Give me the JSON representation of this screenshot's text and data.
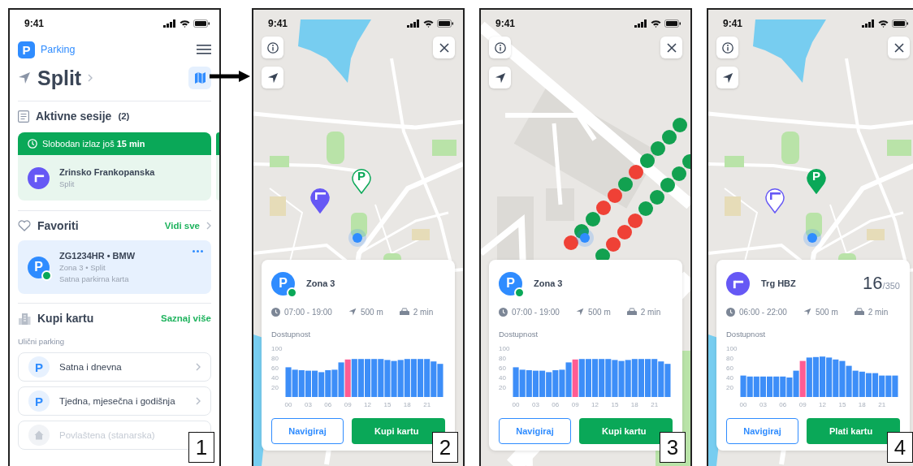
{
  "screens": [
    {
      "kind": "home",
      "label": "1",
      "status_bar": {
        "time": "9:41"
      },
      "header": {
        "logo": "P",
        "app_name": "Parking"
      },
      "city": {
        "name": "Split"
      },
      "active_sessions": {
        "title": "Aktivne sesije",
        "count": "(2)",
        "sessions": [
          {
            "banner": "Slobodan izlaz još **15 min**",
            "name": "Zrinsko Frankopanska",
            "city": "Split"
          }
        ]
      },
      "favorites": {
        "title": "Favoriti",
        "link": "Vidi sve",
        "items": [
          {
            "glyph": "P",
            "title": "ZG1234HR • BMW",
            "subtitle": "Zona 3 • Split",
            "detail": "Satna parkirna karta",
            "active": true
          }
        ]
      },
      "buy": {
        "title": "Kupi kartu",
        "link": "Saznaj više",
        "group": "Ulični parking",
        "options": [
          {
            "kind": "zone",
            "glyph": "P",
            "label": "Satna i dnevna",
            "disabled": false
          },
          {
            "kind": "zone",
            "glyph": "P",
            "label": "Tjedna, mjesečna i godišnja",
            "disabled": false
          },
          {
            "kind": "home",
            "label": "Povlaštena (stanarska)",
            "disabled": true
          }
        ]
      }
    },
    {
      "kind": "map",
      "label": "2",
      "status_bar": {
        "time": "9:41"
      },
      "map": {
        "kind": "overview"
      },
      "pins": [
        {
          "kind": "garage",
          "selected": false
        },
        {
          "kind": "zone",
          "glyph": "P",
          "selected": true
        }
      ],
      "card": {
        "kind": "zone",
        "glyph": "P",
        "active": true,
        "name": "Zona 3",
        "hours": "07:00 - 19:00",
        "distance": "500 m",
        "drive_time": "2 min",
        "chart_data": {
          "type": "bar",
          "title": "Dostupnost",
          "x": [
            0,
            1,
            2,
            3,
            4,
            5,
            6,
            7,
            8,
            9,
            10,
            11,
            12,
            13,
            14,
            15,
            16,
            17,
            18,
            19,
            20,
            21,
            22,
            23
          ],
          "series": [
            {
              "color": "#3d8ef8",
              "values": [
                61,
                56,
                55,
                54,
                54,
                51,
                55,
                56,
                71,
                null,
                78,
                78,
                78,
                78,
                78,
                76,
                74,
                76,
                78,
                78,
                78,
                78,
                73,
                68
              ]
            },
            {
              "color": "#ff5c93",
              "values": [
                null,
                null,
                null,
                null,
                null,
                null,
                null,
                null,
                null,
                77,
                null,
                null,
                null,
                null,
                null,
                null,
                null,
                null,
                null,
                null,
                null,
                null,
                null,
                null
              ]
            }
          ],
          "xlim": [
            -0.5,
            23.5
          ],
          "ylim": [
            0,
            100
          ],
          "yticks": [
            20,
            40,
            60,
            80,
            100
          ],
          "xticks": [
            {
              "value": 0,
              "label": "00"
            },
            {
              "value": 3,
              "label": "03"
            },
            {
              "value": 6,
              "label": "06"
            },
            {
              "value": 9,
              "label": "09"
            },
            {
              "value": 12,
              "label": "12"
            },
            {
              "value": 15,
              "label": "15"
            },
            {
              "value": 18,
              "label": "18"
            },
            {
              "value": 21,
              "label": "21"
            }
          ]
        },
        "buttons": [
          {
            "kind": "outline",
            "label": "Navigiraj"
          },
          {
            "kind": "primary",
            "label": "Kupi kartu"
          }
        ]
      }
    },
    {
      "kind": "map",
      "label": "3",
      "status_bar": {
        "time": "9:41"
      },
      "map": {
        "kind": "street"
      },
      "spot_rows": [
        {
          "spots": [
            {
              "color": "#12a150"
            },
            {
              "color": "#12a150"
            },
            {
              "color": "#12a150"
            },
            {
              "color": "#12a150"
            },
            {
              "color": "#ef4136"
            },
            {
              "color": "#12a150"
            },
            {
              "color": "#ef4136"
            },
            {
              "color": "#ef4136"
            },
            {
              "color": "#12a150"
            },
            {
              "color": "#12a150"
            },
            {
              "color": "#ef4136"
            }
          ]
        },
        {
          "spots": [
            {
              "color": "#12a150"
            },
            {
              "color": "#12a150"
            },
            {
              "color": "#12a150"
            },
            {
              "color": "#12a150"
            },
            {
              "color": "#12a150"
            },
            {
              "color": "#ef4136"
            },
            {
              "color": "#ef4136"
            },
            {
              "color": "#ef4136"
            },
            {
              "color": "#12a150"
            }
          ]
        }
      ],
      "card": {
        "kind": "zone",
        "glyph": "P",
        "active": true,
        "name": "Zona 3",
        "hours": "07:00 - 19:00",
        "distance": "500 m",
        "drive_time": "2 min",
        "chart_data": {
          "type": "bar",
          "title": "Dostupnost",
          "x": [
            0,
            1,
            2,
            3,
            4,
            5,
            6,
            7,
            8,
            9,
            10,
            11,
            12,
            13,
            14,
            15,
            16,
            17,
            18,
            19,
            20,
            21,
            22,
            23
          ],
          "series": [
            {
              "color": "#3d8ef8",
              "values": [
                61,
                56,
                55,
                54,
                54,
                51,
                55,
                56,
                71,
                null,
                78,
                78,
                78,
                78,
                78,
                76,
                74,
                76,
                78,
                78,
                78,
                78,
                73,
                68
              ]
            },
            {
              "color": "#ff5c93",
              "values": [
                null,
                null,
                null,
                null,
                null,
                null,
                null,
                null,
                null,
                77,
                null,
                null,
                null,
                null,
                null,
                null,
                null,
                null,
                null,
                null,
                null,
                null,
                null,
                null
              ]
            }
          ],
          "xlim": [
            -0.5,
            23.5
          ],
          "ylim": [
            0,
            100
          ],
          "yticks": [
            20,
            40,
            60,
            80,
            100
          ],
          "xticks": [
            {
              "value": 0,
              "label": "00"
            },
            {
              "value": 3,
              "label": "03"
            },
            {
              "value": 6,
              "label": "06"
            },
            {
              "value": 9,
              "label": "09"
            },
            {
              "value": 12,
              "label": "12"
            },
            {
              "value": 15,
              "label": "15"
            },
            {
              "value": 18,
              "label": "18"
            },
            {
              "value": 21,
              "label": "21"
            }
          ]
        },
        "buttons": [
          {
            "kind": "outline",
            "label": "Navigiraj"
          },
          {
            "kind": "primary",
            "label": "Kupi kartu"
          }
        ]
      }
    },
    {
      "kind": "map",
      "label": "4",
      "status_bar": {
        "time": "9:41"
      },
      "map": {
        "kind": "overview"
      },
      "pins": [
        {
          "kind": "garage",
          "selected": true
        },
        {
          "kind": "zone",
          "glyph": "P",
          "selected": false
        }
      ],
      "card": {
        "kind": "garage",
        "name": "Trg HBZ",
        "free": "16",
        "capacity": "/350",
        "hours": "06:00 - 22:00",
        "distance": "500 m",
        "drive_time": "2 min",
        "chart_data": {
          "type": "bar",
          "title": "Dostupnost",
          "x": [
            0,
            1,
            2,
            3,
            4,
            5,
            6,
            7,
            8,
            9,
            10,
            11,
            12,
            13,
            14,
            15,
            16,
            17,
            18,
            19,
            20,
            21,
            22,
            23
          ],
          "series": [
            {
              "color": "#3d8ef8",
              "values": [
                44,
                42,
                42,
                42,
                42,
                42,
                42,
                40,
                54,
                null,
                81,
                82,
                83,
                81,
                77,
                74,
                64,
                54,
                52,
                49,
                49,
                44,
                44,
                44
              ]
            },
            {
              "color": "#ff5c93",
              "values": [
                null,
                null,
                null,
                null,
                null,
                null,
                null,
                null,
                null,
                74,
                null,
                null,
                null,
                null,
                null,
                null,
                null,
                null,
                null,
                null,
                null,
                null,
                null,
                null
              ]
            }
          ],
          "xlim": [
            -0.5,
            23.5
          ],
          "ylim": [
            0,
            100
          ],
          "yticks": [
            20,
            40,
            60,
            80,
            100
          ],
          "xticks": [
            {
              "value": 0,
              "label": "00"
            },
            {
              "value": 3,
              "label": "03"
            },
            {
              "value": 6,
              "label": "06"
            },
            {
              "value": 9,
              "label": "09"
            },
            {
              "value": 12,
              "label": "12"
            },
            {
              "value": 15,
              "label": "15"
            },
            {
              "value": 18,
              "label": "18"
            },
            {
              "value": 21,
              "label": "21"
            }
          ]
        },
        "buttons": [
          {
            "kind": "outline",
            "label": "Navigiraj"
          },
          {
            "kind": "primary",
            "label": "Plati kartu"
          }
        ]
      }
    }
  ]
}
